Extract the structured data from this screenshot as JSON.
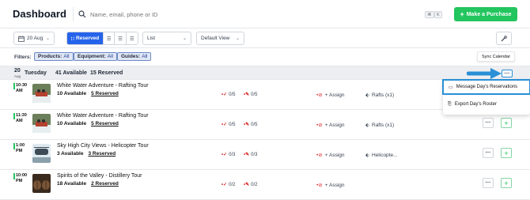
{
  "header": {
    "title": "Dashboard",
    "search_placeholder": "Name, email, phone or ID",
    "kbd_keys": [
      "⌘",
      "K"
    ],
    "make_purchase": "Make a Purchase"
  },
  "toolbar": {
    "date": "20 Aug",
    "view_mode_active": "Reserved",
    "list_select": "List",
    "view_select": "Default View"
  },
  "filters": {
    "label": "Filters:",
    "chips": [
      {
        "name": "Products:",
        "value": "All"
      },
      {
        "name": "Equipment:",
        "value": "All"
      },
      {
        "name": "Guides:",
        "value": "All"
      }
    ],
    "sync_calendar": "Sync Calendar"
  },
  "day": {
    "day_num": "20",
    "month": "Aug",
    "weekday": "Tuesday",
    "available": "41 Available",
    "reserved": "15 Reserved"
  },
  "dropdown": {
    "items": [
      "Message Day's Reservations",
      "Export Day's Roster"
    ]
  },
  "rows": [
    {
      "time": "10:30 AM",
      "name": "White Water Adventure - Rafting Tour",
      "available": "10 Available",
      "reserved": "5 Reserved",
      "checked": "0/5",
      "waivers": "0/5",
      "assign": "+ Assign",
      "equipment": "Rafts (x1)"
    },
    {
      "time": "11:30 AM",
      "name": "White Water Adventure - Rafting Tour",
      "available": "10 Available",
      "reserved": "5 Reserved",
      "checked": "0/5",
      "waivers": "0/5",
      "assign": "+ Assign",
      "equipment": "Rafts (x1)"
    },
    {
      "time": "1:00 PM",
      "name": "Sky High City Views - Helicopter Tour",
      "available": "3 Available",
      "reserved": "3 Reserved",
      "checked": "0/3",
      "waivers": "0/3",
      "assign": "+ Assign",
      "equipment": "Helicopte..."
    },
    {
      "time": "10:00 PM",
      "name": "Spirits of the Valley - Distillery Tour",
      "available": "18 Available",
      "reserved": "2 Reserved",
      "checked": "0/2",
      "waivers": "0/2",
      "assign": "+ Assign",
      "equipment": ""
    }
  ],
  "colors": {
    "accent": "#2563eb",
    "primary_button": "#22c55e",
    "highlight": "#2a8fd6"
  }
}
